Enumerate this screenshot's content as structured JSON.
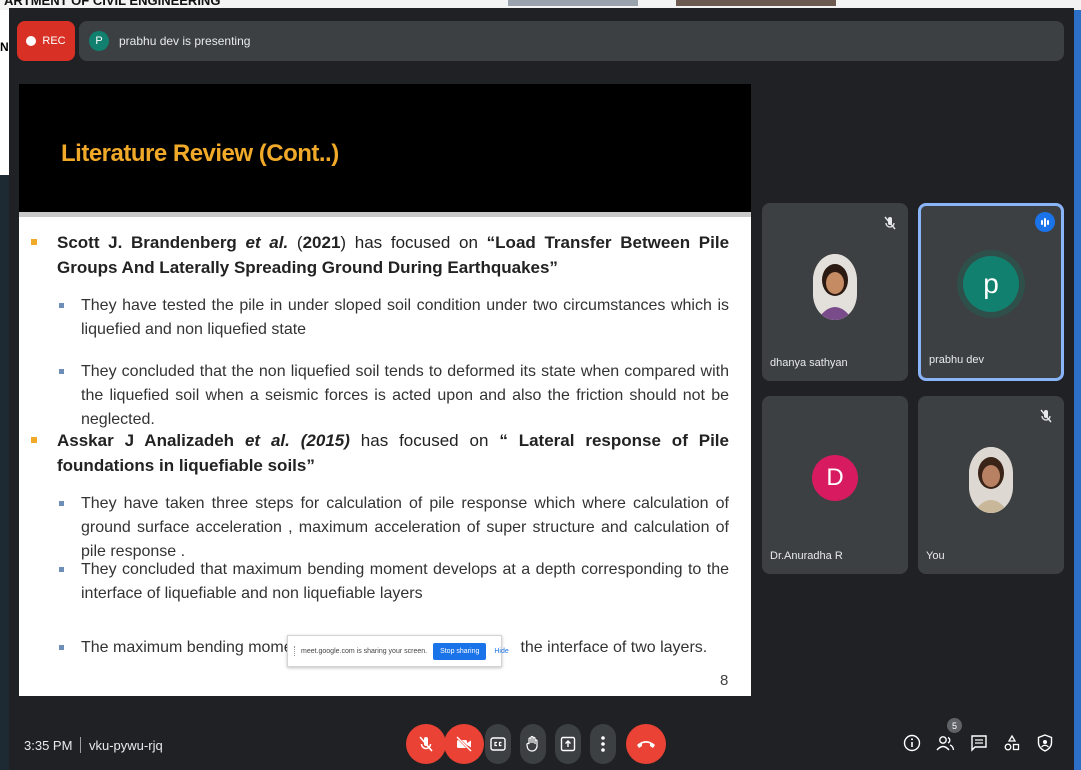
{
  "background": {
    "dept_text": "ARTMENT OF CIVIL ENGINEERING",
    "left_fragment": "N"
  },
  "recording": {
    "label": "REC"
  },
  "presenter": {
    "initial": "P",
    "status": "prabhu dev is presenting"
  },
  "slide": {
    "title": "Literature Review (Cont..)",
    "page_number": "8",
    "entry1": {
      "author": "Scott J. Brandenberg",
      "etal": "et al.",
      "year_open": "(",
      "year": "2021",
      "year_close": ")",
      "mid": "has focused on",
      "topic": "“Load Transfer Between Pile Groups And Laterally Spreading Ground During Earthquakes”",
      "points": [
        "They have tested the pile in under sloped soil condition under two circumstances  which is liquefied and non liquefied state",
        "They concluded that the non liquefied soil tends to deformed its state when compared with the liquefied soil when a seismic forces is acted upon  and also the friction should not be neglected."
      ]
    },
    "entry2": {
      "author": "Asskar J Analizadeh",
      "etal_year": "et al. (2015)",
      "mid": "has focused on",
      "topic": "“ Lateral response of Pile foundations in liquefiable soils”",
      "points": [
        "They have taken three steps for calculation of pile response which where calculation of ground surface acceleration , maximum acceleration of super structure and calculation of pile response .",
        "They concluded that maximum bending moment develops at a depth corresponding to the interface of liquefiable and non liquefiable layers"
      ],
      "last_point_start": "The maximum bending momen",
      "last_point_end": "the interface of two layers."
    }
  },
  "share_notice": {
    "message": "meet.google.com is sharing your screen.",
    "stop_label": "Stop sharing",
    "hide_label": "Hide"
  },
  "participants": [
    {
      "name": "dhanya sathyan",
      "muted": true
    },
    {
      "name": "prabhu dev",
      "initial": "p",
      "avatar_color": "#12806f",
      "speaking": true
    },
    {
      "name": "Dr.Anuradha R",
      "initial": "D",
      "avatar_color": "#d81b60"
    },
    {
      "name": "You",
      "muted": true
    }
  ],
  "bottom_bar": {
    "time": "3:35 PM",
    "meeting_code": "vku-pywu-rjq",
    "people_count": "5"
  },
  "colors": {
    "meet_bg": "#202124",
    "tile_bg": "#3c4043",
    "danger": "#ea4335",
    "title_accent": "#f0a928",
    "active_border": "#8ab4f8"
  },
  "icons": [
    "mic-off-icon",
    "camera-off-icon",
    "captions-icon",
    "raise-hand-icon",
    "present-icon",
    "more-options-icon",
    "end-call-icon",
    "info-icon",
    "people-icon",
    "chat-icon",
    "activities-icon",
    "host-controls-icon"
  ]
}
